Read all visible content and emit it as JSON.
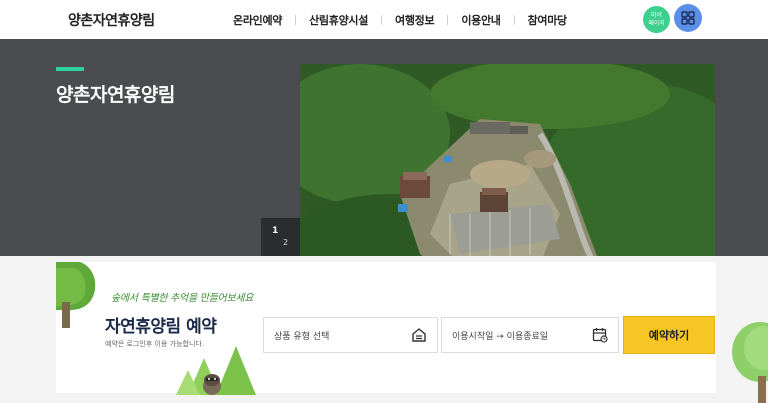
{
  "header": {
    "logo": "양촌자연휴양림",
    "nav": [
      "온라인예약",
      "산림휴양시설",
      "여행정보",
      "이용안내",
      "참여마당"
    ],
    "mypage_line1": "마이",
    "mypage_line2": "페이지"
  },
  "hero": {
    "title": "양촌자연휴양림",
    "slider": {
      "current": "1",
      "total": "2"
    }
  },
  "reservation": {
    "tagline": "숲에서 특별한 추억을 만들어보세요",
    "title": "자연휴양림 예약",
    "note": "예약은 로그인후 이용 가능합니다.",
    "product_placeholder": "상품 유형 선택",
    "date_placeholder": "이용시작일 → 이용종료일",
    "button": "예약하기"
  },
  "colors": {
    "accent": "#2fd19a",
    "hero_bg": "#4a4c4f",
    "button": "#f6c624",
    "mypage": "#3ccf8e",
    "menu": "#5b8fe8"
  },
  "icons": [
    "grid-menu-icon",
    "product-icon",
    "calendar-icon",
    "arrow-left-icon",
    "arrow-right-icon"
  ]
}
